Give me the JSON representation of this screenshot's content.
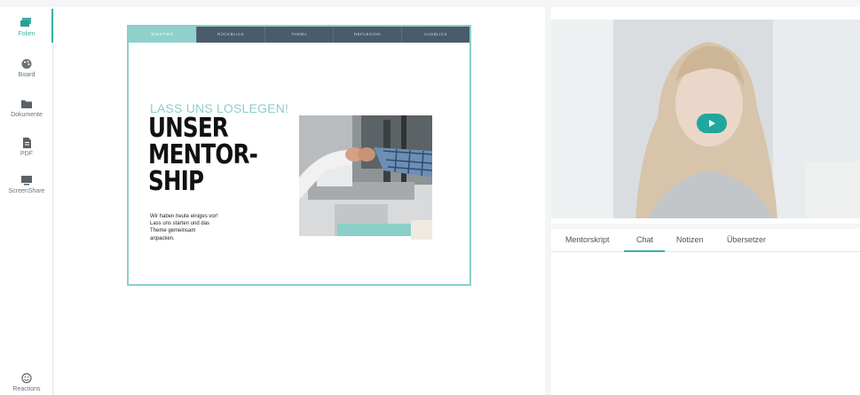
{
  "sidebar": {
    "items": [
      {
        "label": "Folien",
        "icon": "slides-icon"
      },
      {
        "label": "Board",
        "icon": "palette-icon"
      },
      {
        "label": "Dokumente",
        "icon": "folder-icon"
      },
      {
        "label": "PDF",
        "icon": "pdf-icon"
      },
      {
        "label": "ScreenShare",
        "icon": "screen-share-icon"
      },
      {
        "label": "Reactions",
        "icon": "smiley-icon"
      }
    ],
    "accent": "#3bb1a8"
  },
  "slide": {
    "tabs": [
      "EINSTIEG",
      "RÜCKBLICK",
      "THEMA",
      "REFLEXION",
      "AUSBLICK"
    ],
    "subtitle": "LASS UNS LOSLEGEN!",
    "title_lines": [
      "UNSER",
      "MENTOR-",
      "SHIP"
    ],
    "body_lines": [
      "Wir haben heute einiges vor!",
      "Lass uns starten und das",
      "Theme gemeinsam",
      "anpacken."
    ]
  },
  "video": {
    "play_icon": "play-icon",
    "button_color": "#21a79d"
  },
  "panel_tabs": {
    "items": [
      "Mentorskript",
      "Chat",
      "Notizen",
      "Übersetzer"
    ],
    "active": "Chat"
  }
}
